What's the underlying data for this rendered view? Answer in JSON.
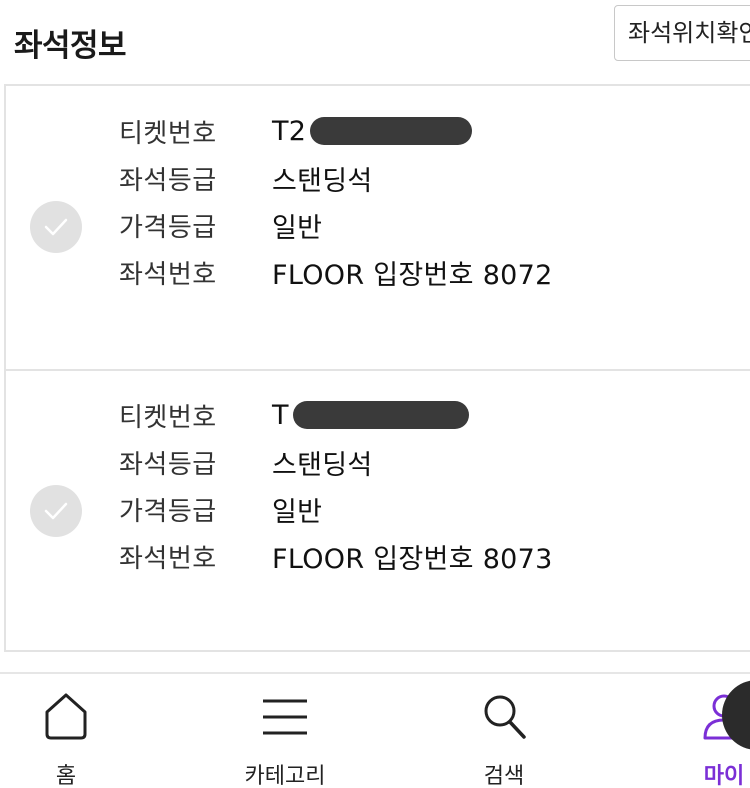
{
  "header": {
    "title": "좌석정보",
    "seat_map_button": "좌석위치확인"
  },
  "seats": [
    {
      "rows": [
        {
          "label": "티켓번호",
          "value": "T2"
        },
        {
          "label": "좌석등급",
          "value": "스탠딩석"
        },
        {
          "label": "가격등급",
          "value": "일반"
        },
        {
          "label": "좌석번호",
          "value": "FLOOR 입장번호 8072"
        }
      ]
    },
    {
      "rows": [
        {
          "label": "티켓번호",
          "value": "T"
        },
        {
          "label": "좌석등급",
          "value": "스탠딩석"
        },
        {
          "label": "가격등급",
          "value": "일반"
        },
        {
          "label": "좌석번호",
          "value": "FLOOR 입장번호 8073"
        }
      ]
    }
  ],
  "bottom_nav": {
    "items": [
      {
        "label": "홈",
        "icon": "home-icon"
      },
      {
        "label": "카테고리",
        "icon": "menu-icon"
      },
      {
        "label": "검색",
        "icon": "search-icon"
      },
      {
        "label": "마이",
        "icon": "user-icon",
        "active": true
      }
    ]
  },
  "colors": {
    "accent": "#7b2fd6",
    "check_circle": "#e1e1e1",
    "divider": "#e3e3e3"
  }
}
